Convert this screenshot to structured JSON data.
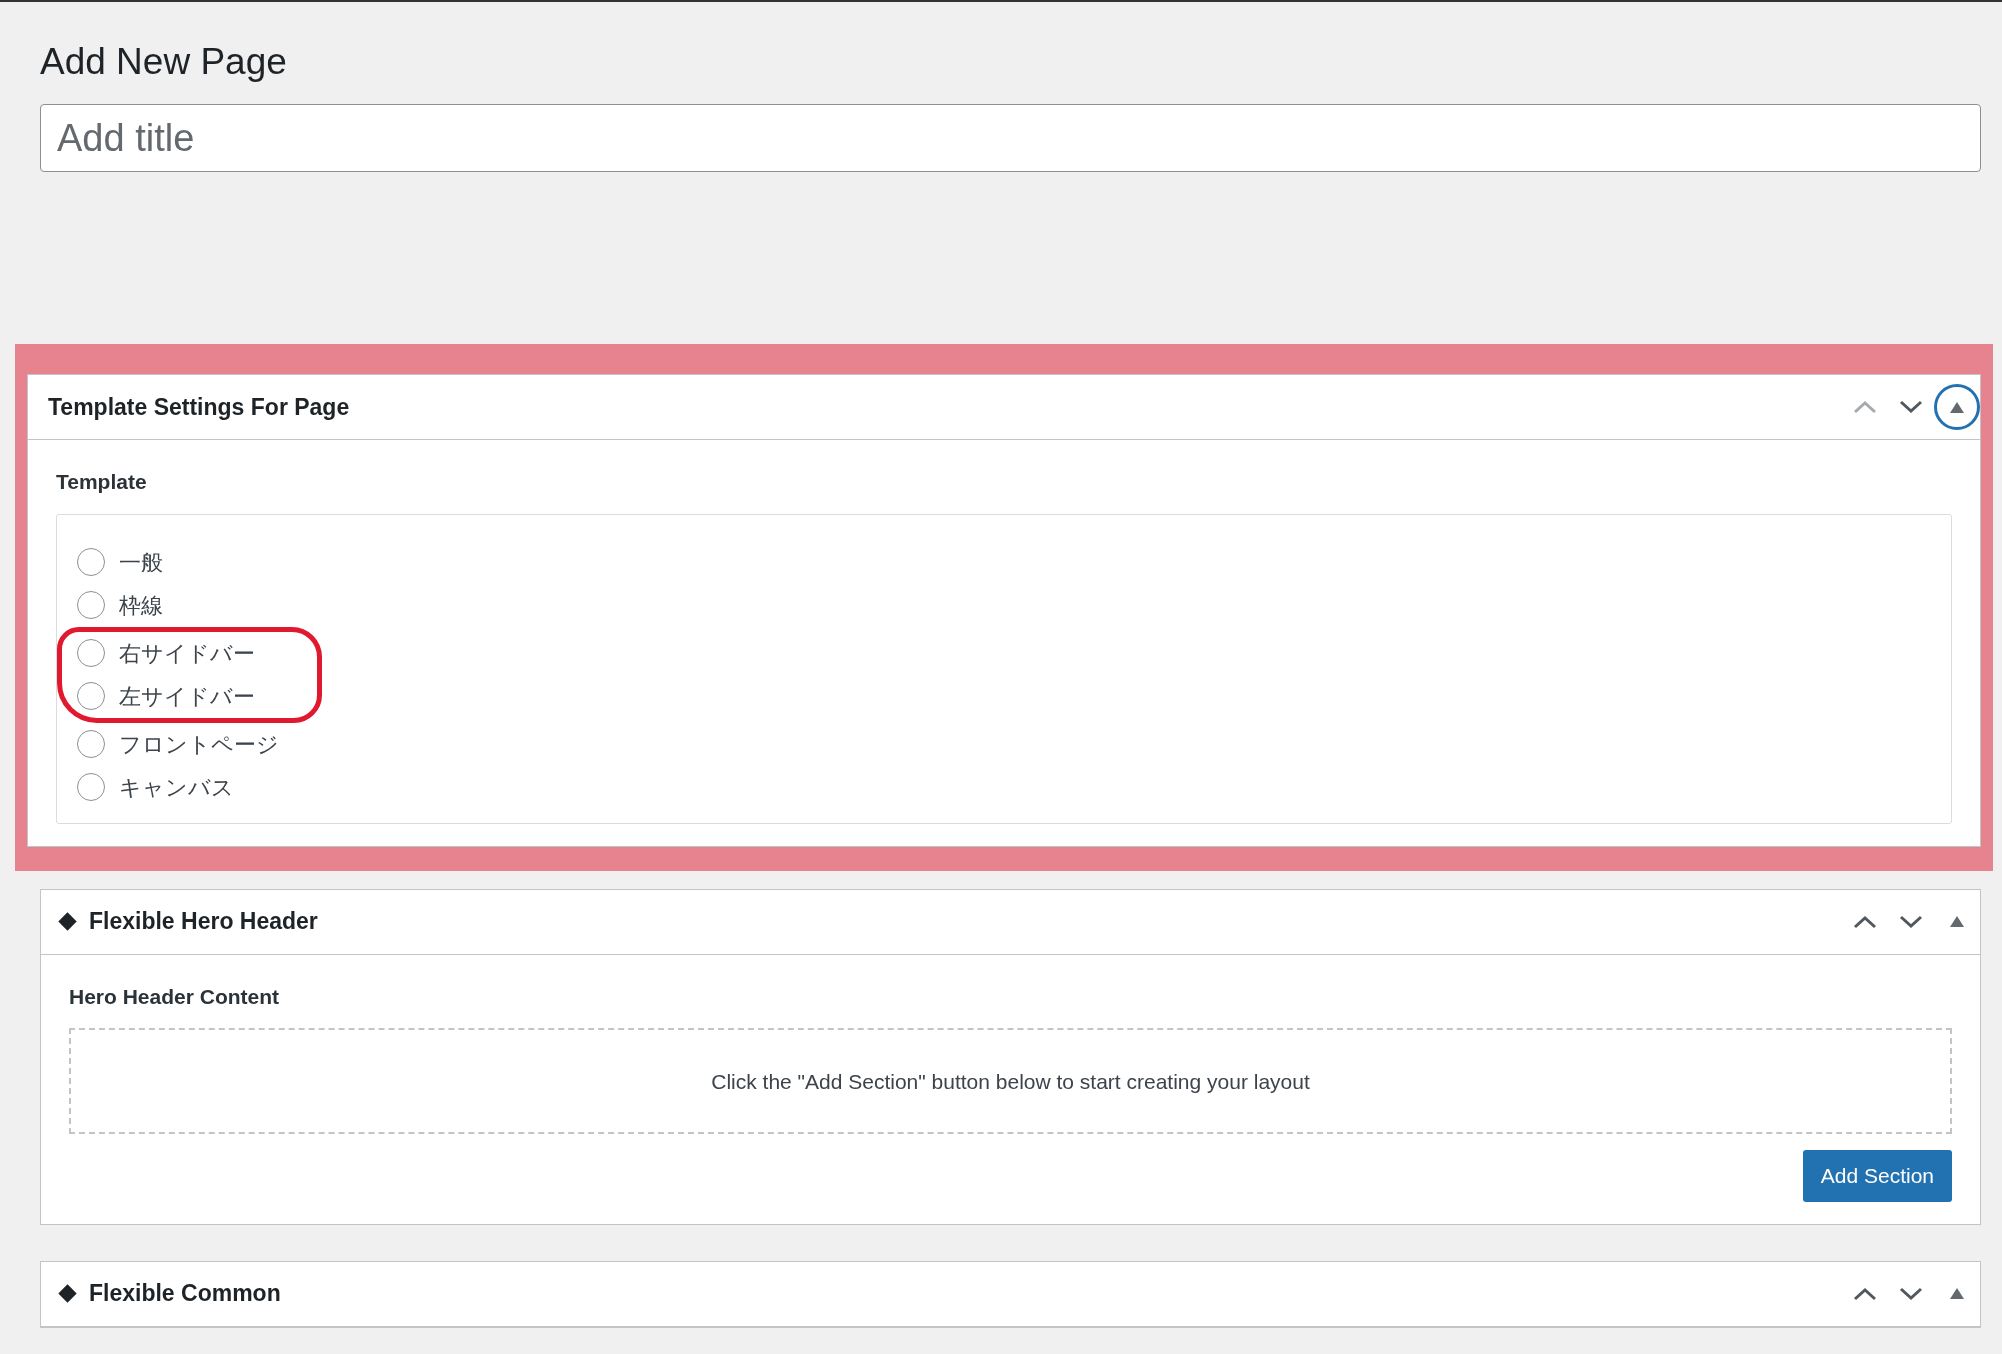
{
  "heading": "Add New Page",
  "title_field": {
    "placeholder": "Add title"
  },
  "panels": [
    {
      "title": "Template Settings For Page",
      "marker": false,
      "highlighted": true,
      "controls": {
        "up_disabled": true,
        "toggle_circled": true
      },
      "body": {
        "kind": "radios",
        "label": "Template",
        "options": [
          {
            "label": "一般",
            "selected": false,
            "circled": false
          },
          {
            "label": "枠線",
            "selected": false,
            "circled": false
          },
          {
            "label": "右サイドバー",
            "selected": false,
            "circled": true
          },
          {
            "label": "左サイドバー",
            "selected": false,
            "circled": true
          },
          {
            "label": "フロントページ",
            "selected": false,
            "circled": false
          },
          {
            "label": "キャンバス",
            "selected": false,
            "circled": false
          }
        ]
      }
    },
    {
      "title": "Flexible Hero Header",
      "marker": true,
      "highlighted": false,
      "controls": {
        "up_disabled": false,
        "toggle_circled": false
      },
      "body": {
        "kind": "layout",
        "label": "Hero Header Content",
        "empty_text": "Click the \"Add Section\" button below to start creating your layout",
        "button": "Add Section"
      }
    },
    {
      "title": "Flexible Common",
      "marker": true,
      "highlighted": false,
      "controls": {
        "up_disabled": false,
        "toggle_circled": false
      }
    }
  ]
}
